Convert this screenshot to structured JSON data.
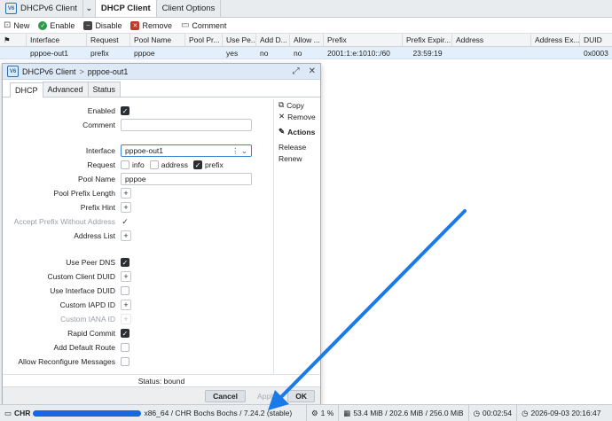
{
  "top_tabs": [
    {
      "label": "DHCPv6 Client",
      "active": false
    },
    {
      "label": "DHCP Client",
      "active": true
    },
    {
      "label": "Client Options",
      "active": false
    }
  ],
  "logo_text": "V6",
  "toolbar": {
    "new": "New",
    "enable": "Enable",
    "disable": "Disable",
    "remove": "Remove",
    "comment": "Comment"
  },
  "table": {
    "headers": [
      "Interface",
      "Request",
      "Pool Name",
      "Pool Pr...",
      "Use Pe...",
      "Add D...",
      "Allow ...",
      "Prefix",
      "Prefix Expir...",
      "Address",
      "Address Ex...",
      "DUID"
    ],
    "row": [
      "pppoe-out1",
      "prefix",
      "pppoe",
      "",
      "yes",
      "no",
      "no",
      "2001:1:e:1010::/60",
      "23:59:19",
      "",
      "",
      "0x0003"
    ]
  },
  "dialog": {
    "title": "DHCPv6 Client",
    "sep": ">",
    "name": "pppoe-out1",
    "tabs": [
      "DHCP",
      "Advanced",
      "Status"
    ],
    "fields": {
      "enabled": "Enabled",
      "comment": "Comment",
      "interface": "Interface",
      "interface_value": "pppoe-out1",
      "request": "Request",
      "request_options": [
        "info",
        "address",
        "prefix"
      ],
      "pool_name": "Pool Name",
      "pool_name_value": "pppoe",
      "pool_prefix_length": "Pool Prefix Length",
      "prefix_hint": "Prefix Hint",
      "accept_prefix": "Accept Prefix Without Address",
      "address_list": "Address List",
      "use_peer_dns": "Use Peer DNS",
      "custom_client_duid": "Custom Client DUID",
      "use_interface_duid": "Use Interface DUID",
      "custom_iapd_id": "Custom IAPD ID",
      "custom_iana_id": "Custom IANA ID",
      "rapid_commit": "Rapid Commit",
      "add_default_route": "Add Default Route",
      "allow_reconfigure": "Allow Reconfigure Messages"
    },
    "side": {
      "copy": "Copy",
      "remove": "Remove",
      "actions": "Actions",
      "release": "Release",
      "renew": "Renew"
    },
    "status": "Status: bound",
    "buttons": {
      "cancel": "Cancel",
      "apply": "Apply",
      "ok": "OK"
    }
  },
  "bottombar": {
    "chr": "CHR",
    "system": "x86_64 / CHR Bochs Bochs / 7.24.2 (stable)",
    "cpu": "1 %",
    "memory": "53.4 MiB / 202.6 MiB / 256.0 MiB",
    "uptime": "00:02:54",
    "datetime": "2026-09-03 20:16:47"
  },
  "colors": {
    "accent": "#1a7be8",
    "redaction": "#1a66e0"
  }
}
